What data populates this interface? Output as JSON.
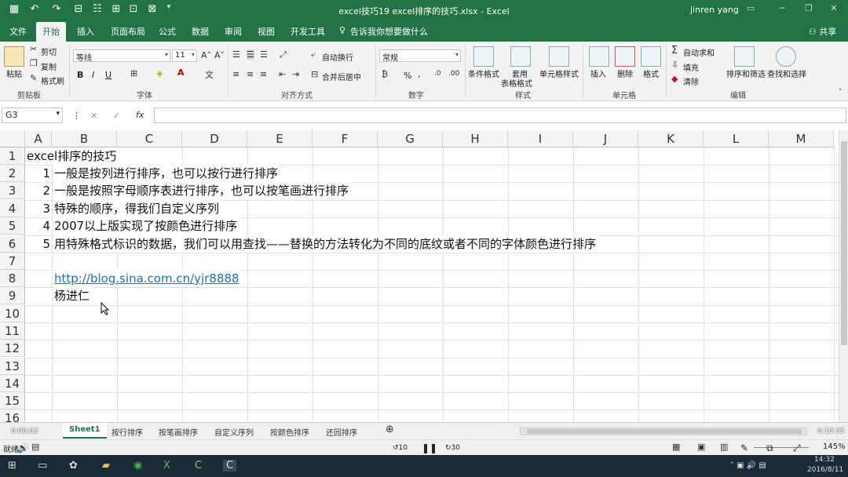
{
  "window": {
    "title": "excel技巧19 excel排序的技巧.xlsx - Excel",
    "user": "jinren yang",
    "share": "共享"
  },
  "tabs": [
    "文件",
    "开始",
    "插入",
    "页面布局",
    "公式",
    "数据",
    "审阅",
    "视图",
    "开发工具"
  ],
  "tell_me": "告诉我你想要做什么",
  "ribbon": {
    "clipboard": {
      "paste": "粘贴",
      "cut": "剪切",
      "copy": "复制",
      "format_painter": "格式刷",
      "label": "剪贴板"
    },
    "font": {
      "name": "等线",
      "size": "11",
      "label": "字体",
      "bold": "B",
      "italic": "I",
      "underline": "U"
    },
    "alignment": {
      "wrap": "自动换行",
      "merge": "合并后居中",
      "label": "对齐方式"
    },
    "number": {
      "format": "常规",
      "label": "数字",
      "percent": "%"
    },
    "styles": {
      "conditional": "条件格式",
      "table_line1": "套用",
      "table_line2": "表格格式",
      "cell_styles": "单元格样式",
      "label": "样式"
    },
    "cells": {
      "insert": "插入",
      "delete": "删除",
      "format": "格式",
      "label": "单元格"
    },
    "editing": {
      "autosum": "自动求和",
      "fill": "填充",
      "clear": "清除",
      "sort": "排序和筛选",
      "find": "查找和选择",
      "label": "编辑"
    }
  },
  "formula_bar": {
    "name_box": "G3",
    "fx": "fx",
    "value": ""
  },
  "columns": [
    "A",
    "B",
    "C",
    "D",
    "E",
    "F",
    "G",
    "H",
    "I",
    "J",
    "K",
    "L",
    "M"
  ],
  "rows": [
    "1",
    "2",
    "3",
    "4",
    "5",
    "6",
    "7",
    "8",
    "9",
    "10",
    "11",
    "12",
    "13",
    "14",
    "15",
    "16"
  ],
  "cells": {
    "a1": "excel排序的技巧",
    "a2": "1",
    "b2": "一般是按列进行排序，也可以按行进行排序",
    "a3": "2",
    "b3": "一般是按照字母顺序表进行排序，也可以按笔画进行排序",
    "a4": "3",
    "b4": "特殊的顺序，得我们自定义序列",
    "a5": "4",
    "b5": "2007以上版实现了按颜色进行排序",
    "a6": "5",
    "b6": "用特殊格式标识的数据，我们可以用查找——替换的方法转化为不同的底纹或者不同的字体颜色进行排序",
    "b8": "http://blog.sina.com.cn/yjr8888",
    "b9": "杨进仁"
  },
  "sheet_tabs": [
    "Sheet1",
    "按行排序",
    "按笔画排序",
    "自定义序列",
    "按颜色排序",
    "还回排序"
  ],
  "status": {
    "ready": "就绪",
    "zoom": "145%"
  },
  "video": {
    "elapsed": "0:00:02",
    "total": "0:10:35",
    "back": "10",
    "forward": "30"
  },
  "clock": {
    "time": "14:32",
    "date": "2016/8/11"
  },
  "colors": {
    "brand": "#217346",
    "link": "#1e6fc3"
  }
}
